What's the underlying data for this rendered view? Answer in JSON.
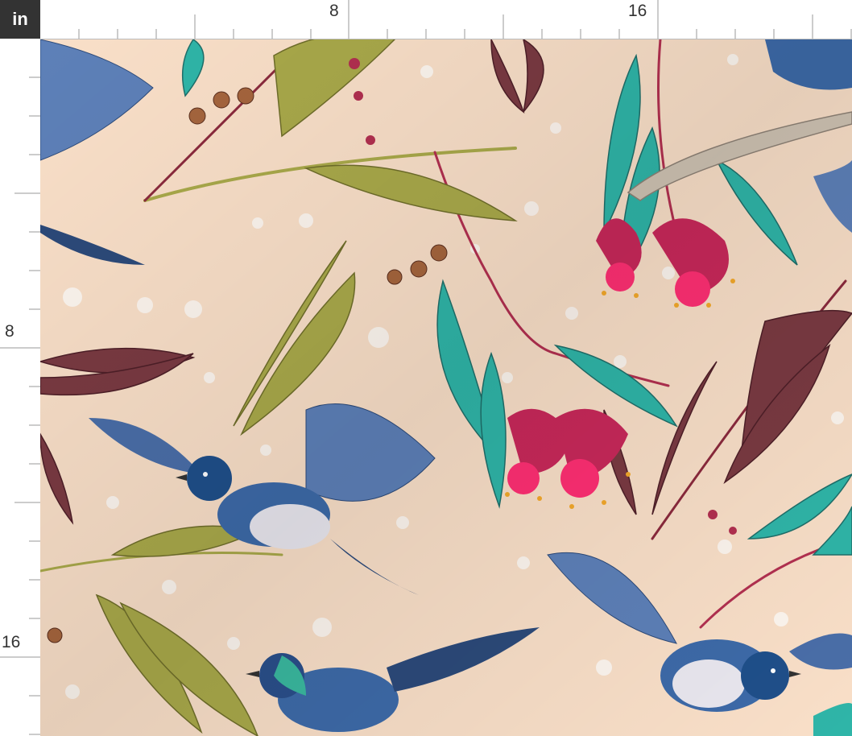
{
  "ruler": {
    "unit": "in",
    "top_labels": [
      "8",
      "16"
    ],
    "left_labels": [
      "8",
      "16"
    ]
  },
  "pattern": {
    "background_color": "#f9dfc8",
    "leaf_teal": "#2fb5a8",
    "leaf_olive": "#a9a94a",
    "leaf_maroon": "#7a3a42",
    "flower_pink": "#e8336a",
    "bird_blue": "#3d6aa8"
  }
}
